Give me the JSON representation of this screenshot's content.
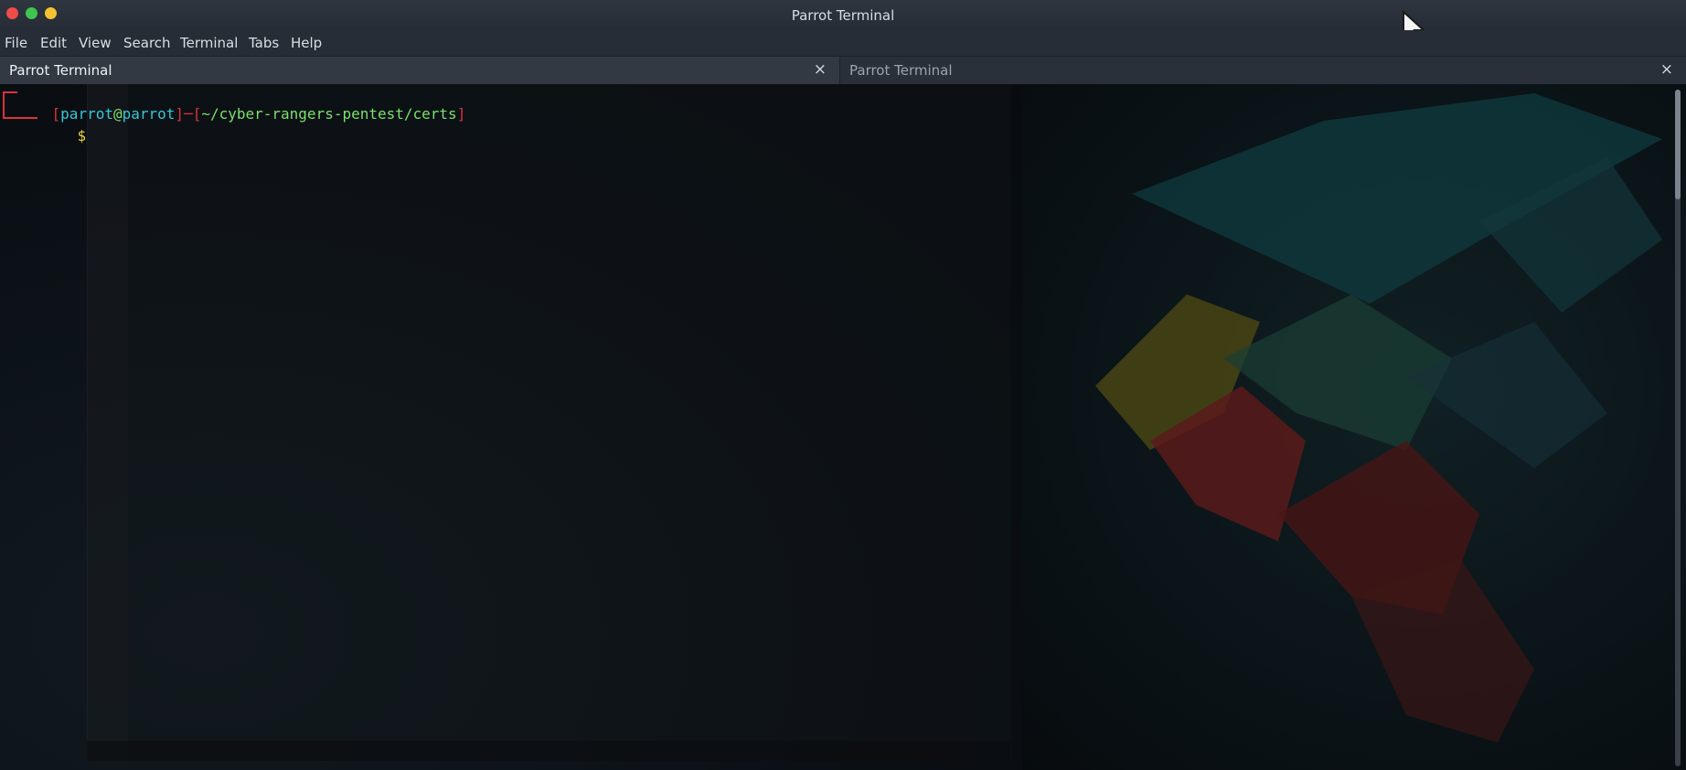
{
  "window": {
    "title": "Parrot Terminal",
    "traffic_lights": {
      "close_color": "#ef4b4b",
      "minimize_color": "#3ec550",
      "maximize_color": "#f5c232"
    }
  },
  "menubar": {
    "items": [
      "File",
      "Edit",
      "View",
      "Search",
      "Terminal",
      "Tabs",
      "Help"
    ]
  },
  "tabs": [
    {
      "label": "Parrot Terminal",
      "active": true,
      "close": "×"
    },
    {
      "label": "Parrot Terminal",
      "active": false,
      "close": "×"
    }
  ],
  "prompt": {
    "open_bracket": "[",
    "user": "parrot",
    "at": "@",
    "host": "parrot",
    "close_bracket": "]",
    "dash": "─",
    "path_open": "[",
    "path": "~/cyber-rangers-pentest/certs",
    "path_close": "]",
    "symbol": "$"
  },
  "colors": {
    "bracket": "#d8333b",
    "user": "#35c9d6",
    "at": "#7be06c",
    "path": "#7be06c",
    "dollar": "#f1d23a",
    "background": "#0c1116"
  },
  "icons": {
    "cursor": "mouse-pointer-icon"
  }
}
